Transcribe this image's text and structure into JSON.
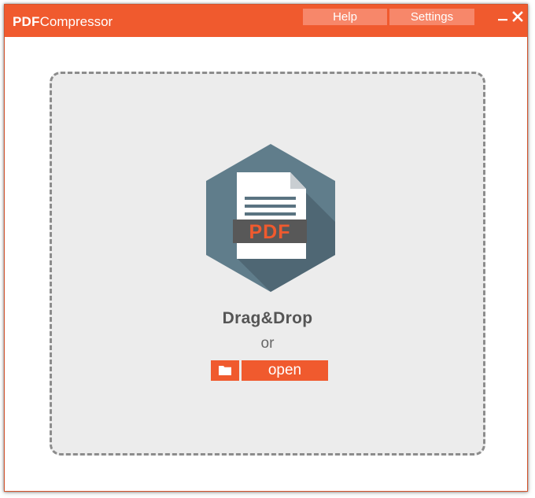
{
  "app": {
    "title_bold": "PDF",
    "title_light": "Compressor"
  },
  "toolbar": {
    "help_label": "Help",
    "settings_label": "Settings"
  },
  "dropzone": {
    "icon_text": "PDF",
    "drag_label": "Drag&Drop",
    "or_label": "or",
    "open_label": "open"
  },
  "colors": {
    "accent": "#f05a2e",
    "tab_button": "#f7876a",
    "hexagon": "#607d8b",
    "dropzone_bg": "#ececec"
  },
  "icons": {
    "minimize": "minimize-icon",
    "close": "close-icon",
    "folder": "folder-icon",
    "pdf_file": "pdf-file-icon"
  }
}
